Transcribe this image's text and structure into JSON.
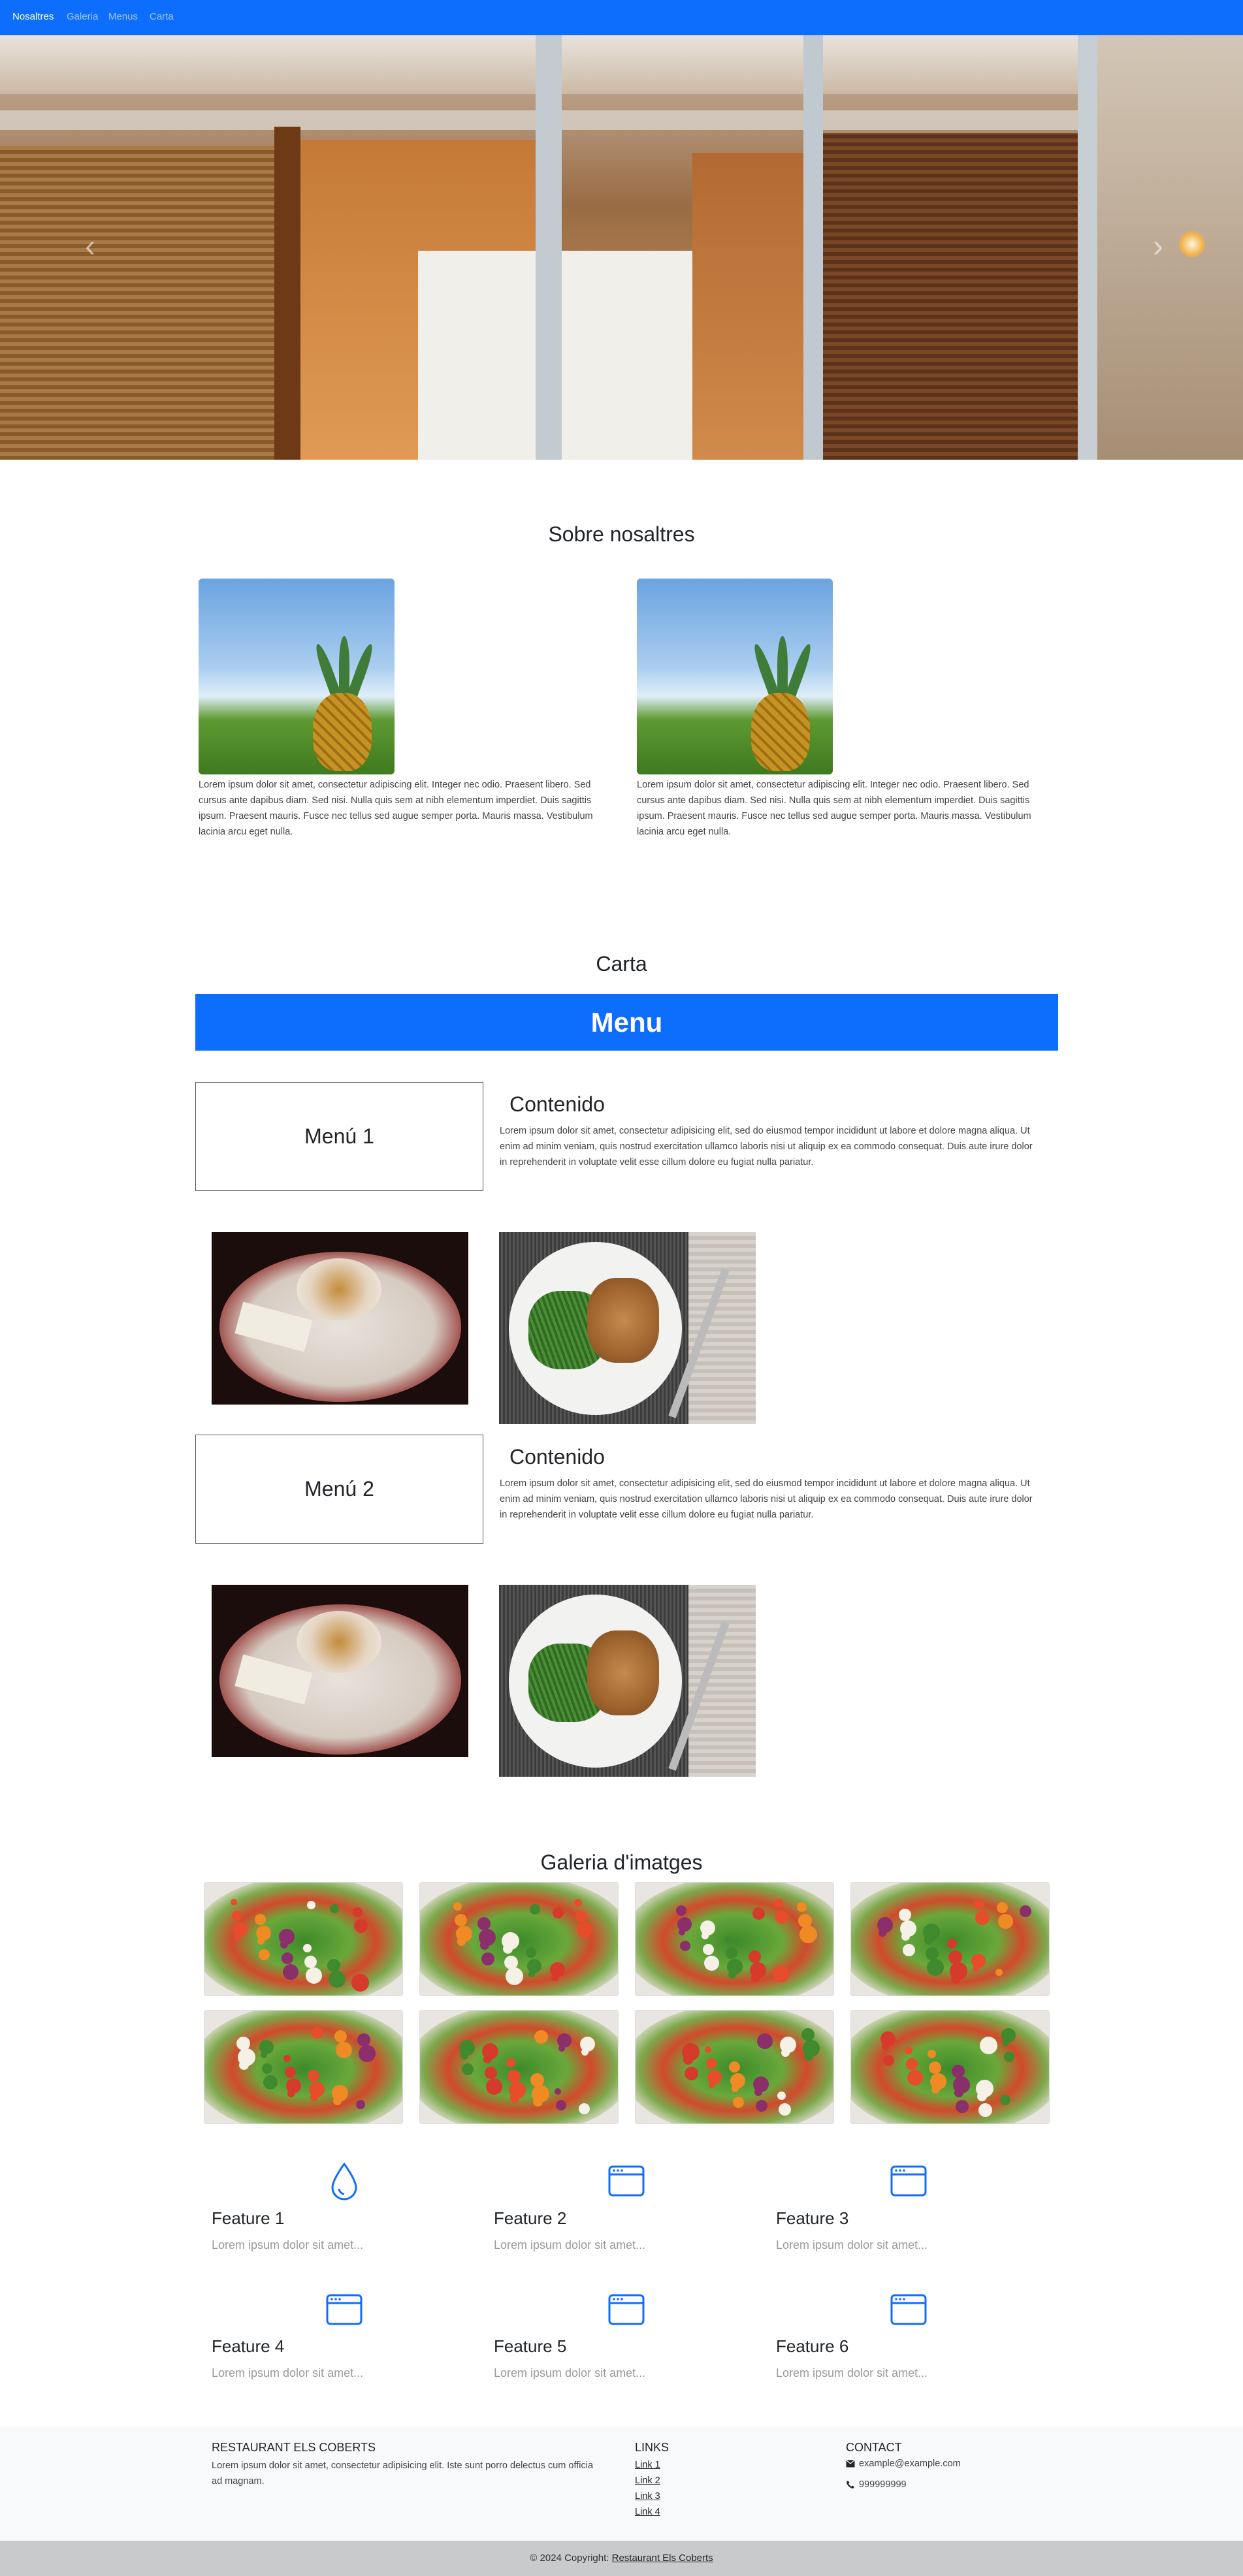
{
  "navbar": {
    "items": [
      "Nosaltres",
      "Galeria",
      "Menus",
      "Carta"
    ],
    "active": "Nosaltres",
    "color": "#0d6efd"
  },
  "hero": {
    "prev_icon": "chevron-left-icon",
    "next_icon": "chevron-right-icon",
    "prev_glyph": "‹",
    "next_glyph": "›"
  },
  "about": {
    "title": "Sobre nosaltres",
    "cards": [
      {
        "text": "Lorem ipsum dolor sit amet, consectetur adipiscing elit. Integer nec odio. Praesent libero. Sed cursus ante dapibus diam. Sed nisi. Nulla quis sem at nibh elementum imperdiet. Duis sagittis ipsum. Praesent mauris. Fusce nec tellus sed augue semper porta. Mauris massa. Vestibulum lacinia arcu eget nulla."
      },
      {
        "text": "Lorem ipsum dolor sit amet, consectetur adipiscing elit. Integer nec odio. Praesent libero. Sed cursus ante dapibus diam. Sed nisi. Nulla quis sem at nibh elementum imperdiet. Duis sagittis ipsum. Praesent mauris. Fusce nec tellus sed augue semper porta. Mauris massa. Vestibulum lacinia arcu eget nulla."
      }
    ]
  },
  "carta": {
    "title": "Carta",
    "banner": "Menu",
    "menus": [
      {
        "name": "Menú 1",
        "heading": "Contenido",
        "text": "Lorem ipsum dolor sit amet, consectetur adipisicing elit, sed do eiusmod tempor incididunt ut labore et dolore magna aliqua. Ut enim ad minim veniam, quis nostrud exercitation ullamco laboris nisi ut aliquip ex ea commodo consequat. Duis aute irure dolor in reprehenderit in voluptate velit esse cillum dolore eu fugiat nulla pariatur."
      },
      {
        "name": "Menú 2",
        "heading": "Contenido",
        "text": "Lorem ipsum dolor sit amet, consectetur adipisicing elit, sed do eiusmod tempor incididunt ut labore et dolore magna aliqua. Ut enim ad minim veniam, quis nostrud exercitation ullamco laboris nisi ut aliquip ex ea commodo consequat. Duis aute irure dolor in reprehenderit in voluptate velit esse cillum dolore eu fugiat nulla pariatur."
      }
    ]
  },
  "gallery": {
    "title": "Galeria d'imatges",
    "count": 8
  },
  "features": [
    {
      "title": "Feature 1",
      "text": "Lorem ipsum dolor sit amet...",
      "icon": "droplet-icon"
    },
    {
      "title": "Feature 2",
      "text": "Lorem ipsum dolor sit amet...",
      "icon": "window-icon"
    },
    {
      "title": "Feature 3",
      "text": "Lorem ipsum dolor sit amet...",
      "icon": "window-icon"
    },
    {
      "title": "Feature 4",
      "text": "Lorem ipsum dolor sit amet...",
      "icon": "window-icon"
    },
    {
      "title": "Feature 5",
      "text": "Lorem ipsum dolor sit amet...",
      "icon": "window-icon"
    },
    {
      "title": "Feature 6",
      "text": "Lorem ipsum dolor sit amet...",
      "icon": "window-icon"
    }
  ],
  "footer": {
    "about_title": "RESTAURANT ELS COBERTS",
    "about_text": "Lorem ipsum dolor sit amet, consectetur adipisicing elit. Iste sunt porro delectus cum officia ad magnam.",
    "links_title": "LINKS",
    "links": [
      "Link 1",
      "Link 2",
      "Link 3",
      "Link 4"
    ],
    "contact_title": "CONTACT",
    "email": "example@example.com",
    "phone": "999999999",
    "copyright_prefix": "© 2024 Copyright: ",
    "copyright_link": "Restaurant Els Coberts"
  },
  "colors": {
    "primary": "#0d6efd",
    "footer_bg": "#f8f9fa",
    "copyright_bg": "#c9cacb"
  }
}
